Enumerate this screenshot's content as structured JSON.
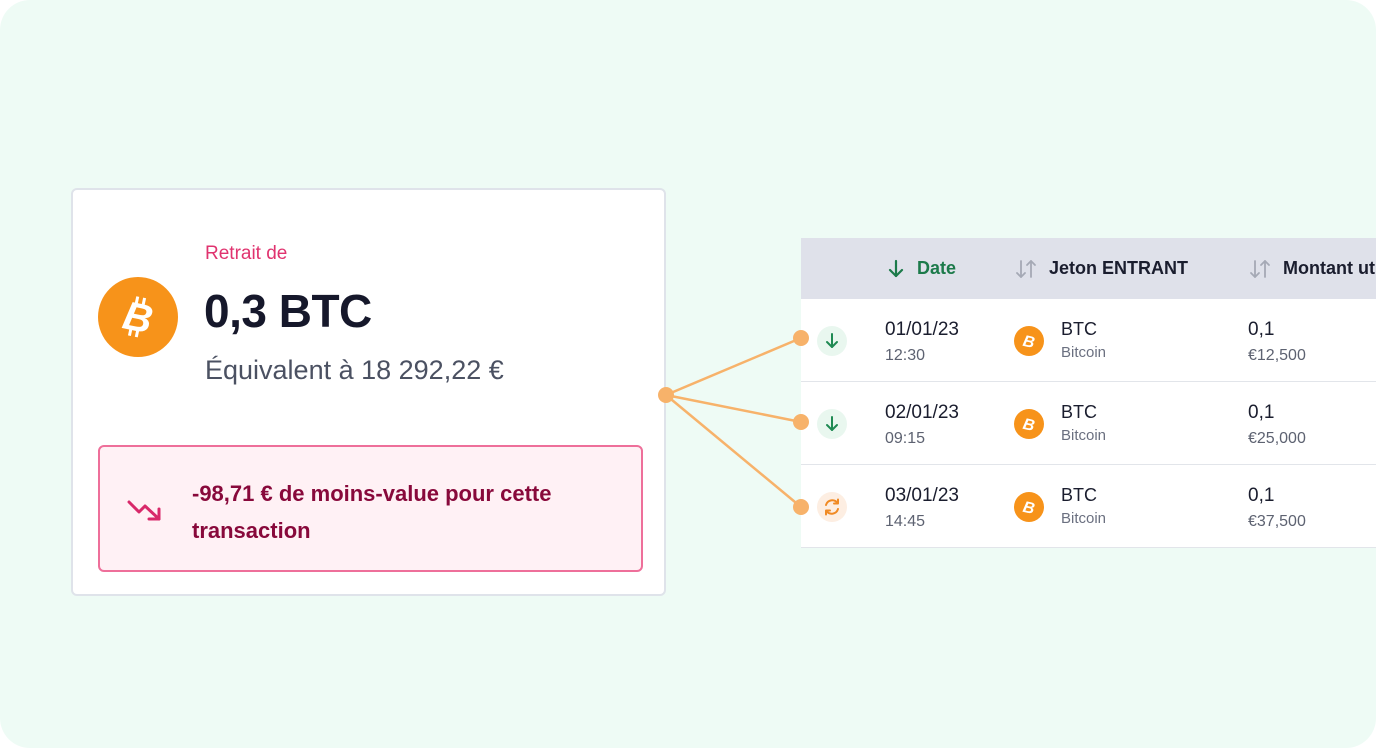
{
  "withdrawal": {
    "label": "Retrait de",
    "amount": "0,3 BTC",
    "equivalent": "Équivalent à 18 292,22 €",
    "coin_icon": "bitcoin-icon",
    "loss_text": "-98,71 € de moins-value pour cette transaction",
    "loss_icon": "trending-down-icon"
  },
  "colors": {
    "background": "#eefbf5",
    "accent_pink": "#e0336f",
    "loss_text": "#88093b",
    "loss_bg": "#fff1f5",
    "bitcoin": "#f7931a",
    "connector": "#f7b26a",
    "sort_active": "#1c7a4a"
  },
  "table": {
    "columns": [
      {
        "label": "Date",
        "sort_icon": "arrow-down-icon",
        "active": true
      },
      {
        "label": "Jeton ENTRANT",
        "sort_icon": "sort-icon",
        "active": false
      },
      {
        "label": "Montant ut",
        "sort_icon": "sort-icon",
        "active": false
      }
    ],
    "rows": [
      {
        "status_icon": "arrow-down-icon",
        "date": "01/01/23",
        "time": "12:30",
        "token": "BTC",
        "token_name": "Bitcoin",
        "amount": "0,1",
        "value": "€12,500"
      },
      {
        "status_icon": "arrow-down-icon",
        "date": "02/01/23",
        "time": "09:15",
        "token": "BTC",
        "token_name": "Bitcoin",
        "amount": "0,1",
        "value": "€25,000"
      },
      {
        "status_icon": "swap-icon",
        "date": "03/01/23",
        "time": "14:45",
        "token": "BTC",
        "token_name": "Bitcoin",
        "amount": "0,1",
        "value": "€37,500"
      }
    ]
  }
}
